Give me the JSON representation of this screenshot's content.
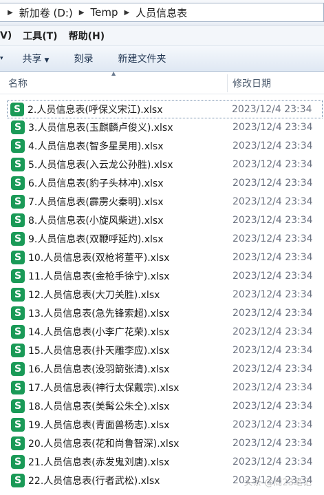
{
  "breadcrumb": [
    {
      "label": "新加卷 (D:)"
    },
    {
      "label": "Temp"
    },
    {
      "label": "人员信息表"
    }
  ],
  "menu": {
    "view_partial": "V)",
    "tools": "工具(T)",
    "help": "帮助(H)"
  },
  "toolbar": {
    "share": "共享",
    "burn": "刻录",
    "new_folder": "新建文件夹"
  },
  "columns": {
    "name": "名称",
    "date": "修改日期"
  },
  "files": [
    {
      "name": "2.人员信息表(呼保义宋江).xlsx",
      "date": "2023/12/4 23:34"
    },
    {
      "name": "3.人员信息表(玉麒麟卢俊义).xlsx",
      "date": "2023/12/4 23:34"
    },
    {
      "name": "4.人员信息表(智多星吴用).xlsx",
      "date": "2023/12/4 23:34"
    },
    {
      "name": "5.人员信息表(入云龙公孙胜).xlsx",
      "date": "2023/12/4 23:34"
    },
    {
      "name": "6.人员信息表(豹子头林冲).xlsx",
      "date": "2023/12/4 23:34"
    },
    {
      "name": "7.人员信息表(霹雳火秦明).xlsx",
      "date": "2023/12/4 23:34"
    },
    {
      "name": "8.人员信息表(小旋风柴进).xlsx",
      "date": "2023/12/4 23:34"
    },
    {
      "name": "9.人员信息表(双鞭呼延灼).xlsx",
      "date": "2023/12/4 23:34"
    },
    {
      "name": "10.人员信息表(双枪将董平).xlsx",
      "date": "2023/12/4 23:34"
    },
    {
      "name": "11.人员信息表(金枪手徐宁).xlsx",
      "date": "2023/12/4 23:34"
    },
    {
      "name": "12.人员信息表(大刀关胜).xlsx",
      "date": "2023/12/4 23:34"
    },
    {
      "name": "13.人员信息表(急先锋索超).xlsx",
      "date": "2023/12/4 23:34"
    },
    {
      "name": "14.人员信息表(小李广花荣).xlsx",
      "date": "2023/12/4 23:34"
    },
    {
      "name": "15.人员信息表(扑天雕李应).xlsx",
      "date": "2023/12/4 23:34"
    },
    {
      "name": "16.人员信息表(没羽箭张清).xlsx",
      "date": "2023/12/4 23:34"
    },
    {
      "name": "17.人员信息表(神行太保戴宗).xlsx",
      "date": "2023/12/4 23:34"
    },
    {
      "name": "18.人员信息表(美髯公朱仝).xlsx",
      "date": "2023/12/4 23:34"
    },
    {
      "name": "19.人员信息表(青面兽杨志).xlsx",
      "date": "2023/12/4 23:34"
    },
    {
      "name": "20.人员信息表(花和尚鲁智深).xlsx",
      "date": "2023/12/4 23:34"
    },
    {
      "name": "21.人员信息表(赤发鬼刘唐).xlsx",
      "date": "2023/12/4 23:34"
    },
    {
      "name": "22.人员信息表(行者武松).xlsx",
      "date": "2023/12/4 23:34"
    }
  ],
  "file_icon_letter": "S",
  "file_icon_color": "#1a9a57",
  "watermark": "头条 @周23笔记"
}
